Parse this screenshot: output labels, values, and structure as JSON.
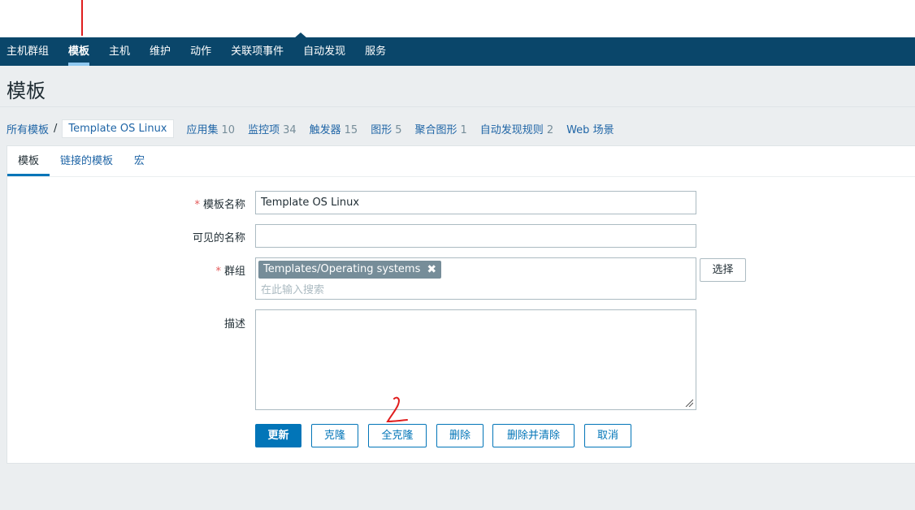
{
  "topnav": {
    "items": [
      "主机群组",
      "模板",
      "主机",
      "维护",
      "动作",
      "关联项事件",
      "自动发现",
      "服务"
    ]
  },
  "page": {
    "title": "模板"
  },
  "breadcrumb": {
    "all": "所有模板",
    "current": "Template OS Linux",
    "links": [
      {
        "label": "应用集",
        "count": "10"
      },
      {
        "label": "监控项",
        "count": "34"
      },
      {
        "label": "触发器",
        "count": "15"
      },
      {
        "label": "图形",
        "count": "5"
      },
      {
        "label": "聚合图形",
        "count": "1"
      },
      {
        "label": "自动发现规则",
        "count": "2"
      },
      {
        "label": "Web 场景",
        "count": ""
      }
    ]
  },
  "tabs": [
    "模板",
    "链接的模板",
    "宏"
  ],
  "form": {
    "name_label": "模板名称",
    "name_value": "Template OS Linux",
    "visible_label": "可见的名称",
    "visible_value": "",
    "groups_label": "群组",
    "group_chip": "Templates/Operating systems",
    "group_search_placeholder": "在此输入搜索",
    "select_button": "选择",
    "desc_label": "描述",
    "desc_value": "",
    "required_mark": "*"
  },
  "buttons": {
    "update": "更新",
    "clone": "克隆",
    "full_clone": "全克隆",
    "delete": "删除",
    "delete_clear": "删除并清除",
    "cancel": "取消"
  },
  "colors": {
    "nav_bg": "#0a466a",
    "accent": "#0275b8",
    "link": "#1f65a6",
    "annotation_red": "#e01e1e"
  }
}
